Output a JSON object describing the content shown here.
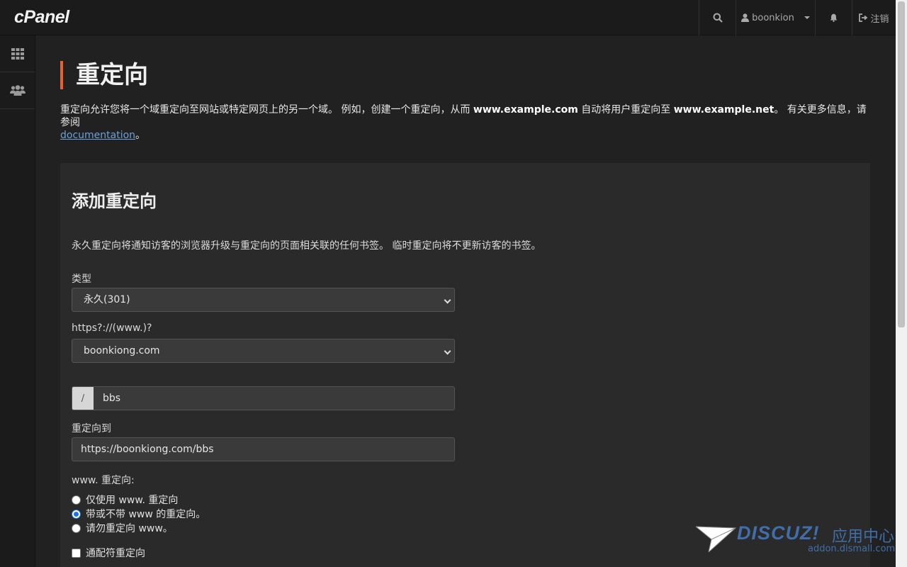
{
  "header": {
    "logo": "cPanel",
    "username": "boonkion",
    "logout_label": "注销"
  },
  "sidebar": {
    "items": [
      {
        "icon": "grid-icon"
      },
      {
        "icon": "users-icon"
      }
    ]
  },
  "page": {
    "title": "重定向",
    "intro_part1": "重定向允许您将一个域重定向至网站或特定网页上的另一个域。 例如，创建一个重定向，从而 ",
    "intro_bold1": "www.example.com",
    "intro_part2": " 自动将用户重定向至 ",
    "intro_bold2": "www.example.net",
    "intro_part3": "。 有关更多信息，请参阅 ",
    "intro_link": "documentation",
    "intro_end": "。"
  },
  "form": {
    "title": "添加重定向",
    "description": "永久重定向将通知访客的浏览器升级与重定向的页面相关联的任何书签。 临时重定向将不更新访客的书签。",
    "type_label": "类型",
    "type_value": "永久(301)",
    "domain_label": "https?://(www.)?",
    "domain_value": "boonkiong.com",
    "path_prefix": "/",
    "path_value": "bbs",
    "redirect_to_label": "重定向到",
    "redirect_to_value": "https://boonkiong.com/bbs",
    "www_label": "www. 重定向:",
    "www_options": [
      {
        "label": "仅使用 www. 重定向",
        "selected": false
      },
      {
        "label": "带或不带 www 的重定向。",
        "selected": true
      },
      {
        "label": "请勿重定向 www。",
        "selected": false
      }
    ],
    "wildcard_label": "通配符重定向",
    "wildcard_checked": false
  },
  "watermark": {
    "brand": "DISCUZ!",
    "cn": "应用中心",
    "url": "addon.dismall.com"
  }
}
